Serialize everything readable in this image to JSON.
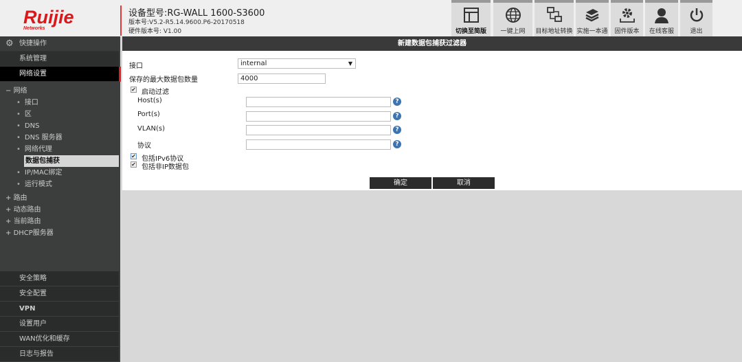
{
  "header": {
    "logo_text": "Ruijie",
    "logo_sub": "Networks",
    "model": "设备型号:RG-WALL 1600-S3600",
    "version": "版本号:V5.2-R5.14.9600.P6-20170518",
    "hardware": "硬件版本号: V1.00"
  },
  "toolbar": [
    {
      "label": "切换至简版",
      "icon": "layout-icon",
      "active": true
    },
    {
      "label": "一键上网",
      "icon": "globe-icon"
    },
    {
      "label": "目标地址转换",
      "icon": "network-nat-icon"
    },
    {
      "label": "实施一本通",
      "icon": "books-icon"
    },
    {
      "label": "固件版本",
      "icon": "gear-upload-icon"
    },
    {
      "label": "在线客服",
      "icon": "headset-user-icon"
    },
    {
      "label": "退出",
      "icon": "power-icon"
    }
  ],
  "sidebar": {
    "quick": "快捷操作",
    "system": "系统管理",
    "network": "网络设置",
    "tree": {
      "network": "网络",
      "children": [
        "接口",
        "区",
        "DNS",
        "DNS 服务器",
        "网络代理",
        "数据包捕获",
        "IP/MAC绑定",
        "运行模式"
      ],
      "others": [
        "路由",
        "动态路由",
        "当前路由",
        "DHCP服务器"
      ]
    },
    "bottom": [
      "安全策略",
      "安全配置",
      "VPN",
      "设置用户",
      "WAN优化和缓存",
      "日志与报告"
    ]
  },
  "content": {
    "title": "新建数据包捕获过滤器",
    "interface_label": "接口",
    "interface_value": "internal",
    "max_label": "保存的最大数据包数量",
    "max_value": "4000",
    "enable_filter": "启动过滤",
    "hosts": "Host(s)",
    "ports": "Port(s)",
    "vlans": "VLAN(s)",
    "protocol": "协议",
    "hosts_value": "",
    "ports_value": "",
    "vlans_value": "",
    "protocol_value": "",
    "ipv6": "包括IPv6协议",
    "nonip": "包括非IP数据包",
    "ok": "确定",
    "cancel": "取消"
  }
}
